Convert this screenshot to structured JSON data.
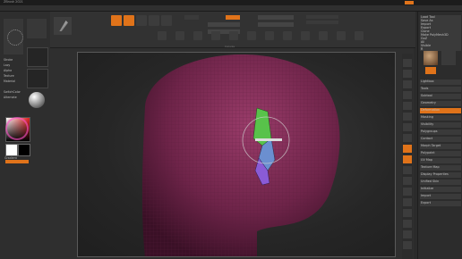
{
  "title_bar": "ZBrush 2021",
  "menu": [
    "Alpha",
    "Brush",
    "Color",
    "Document",
    "Draw",
    "Edit",
    "File",
    "Layer",
    "Light",
    "Macro",
    "Marker",
    "Material",
    "Movie",
    "Picker",
    "Preferences",
    "Render",
    "Stencil",
    "Stroke",
    "Texture",
    "Tool",
    "Transform",
    "Zplugin",
    "Zscript"
  ],
  "left_panel": {
    "label_rgb": "Rgb",
    "label_mrgb": "Mrgb",
    "label_m": "M",
    "items": [
      "Stroke",
      "Lazy",
      "Alpha",
      "Texture",
      "Material",
      "Gradient",
      "SwitchColor",
      "Alternate"
    ]
  },
  "canvas_label": "Canvas",
  "right_panel": {
    "rows": [
      "Load Tool",
      "Save As",
      "Import",
      "Export",
      "Clone",
      "Make PolyMesh3D",
      "GoZ",
      "All",
      "Visible",
      "R",
      "Lightbox",
      "Tools",
      "Subtool",
      "Geometry",
      "Deformation",
      "Masking",
      "Visibility",
      "Polygroups",
      "Contact",
      "Morph Target",
      "Polypaint",
      "UV Map",
      "Texture Map",
      "Display Properties",
      "Unified Skin",
      "Initialize",
      "Import",
      "Export"
    ]
  },
  "colors": {
    "accent": "#e0731a",
    "mesh": "#7a2a52",
    "cutter_green": "#58c24a",
    "cutter_purple": "#8a5bd6"
  }
}
